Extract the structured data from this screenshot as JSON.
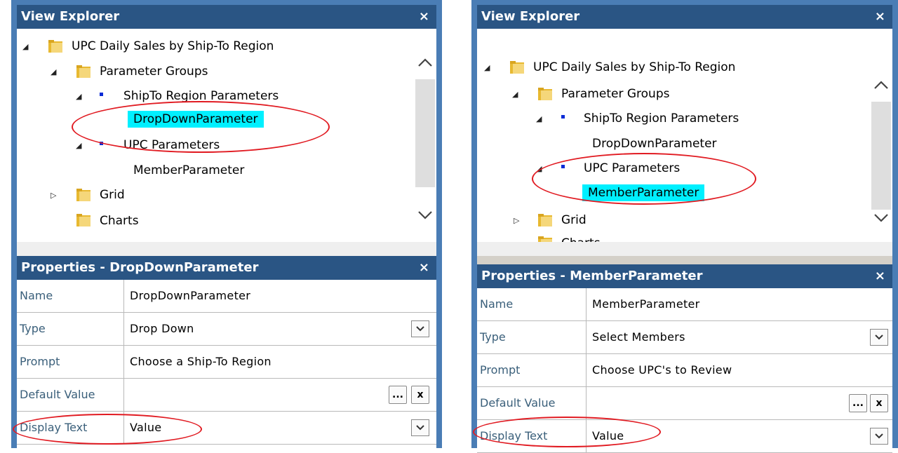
{
  "left": {
    "explorer_title": "View Explorer",
    "tree": {
      "root": "UPC Daily Sales by Ship-To Region",
      "param_groups": "Parameter Groups",
      "group1": "ShipTo Region Parameters",
      "group1_child": "DropDownParameter",
      "group2": "UPC Parameters",
      "group2_child": "MemberParameter",
      "grid": "Grid",
      "charts": "Charts"
    },
    "props_title": "Properties - DropDownParameter",
    "props": [
      {
        "key": "Name",
        "value": "DropDownParameter"
      },
      {
        "key": "Type",
        "value": "Drop Down"
      },
      {
        "key": "Prompt",
        "value": "Choose a Ship-To Region"
      },
      {
        "key": "Default Value",
        "value": ""
      },
      {
        "key": "Display Text",
        "value": "Value"
      }
    ]
  },
  "right": {
    "explorer_title": "View Explorer",
    "tree": {
      "root": "UPC Daily Sales by Ship-To Region",
      "param_groups": "Parameter Groups",
      "group1": "ShipTo Region Parameters",
      "group1_child": "DropDownParameter",
      "group2": "UPC Parameters",
      "group2_child": "MemberParameter",
      "grid": "Grid",
      "charts": "Charts"
    },
    "props_title": "Properties - MemberParameter",
    "props": [
      {
        "key": "Name",
        "value": "MemberParameter"
      },
      {
        "key": "Type",
        "value": "Select Members"
      },
      {
        "key": "Prompt",
        "value": "Choose UPC's to Review"
      },
      {
        "key": "Default Value",
        "value": ""
      },
      {
        "key": "Display Text",
        "value": "Value"
      }
    ]
  },
  "icons": {
    "close": "×",
    "ellipsis": "...",
    "clear": "x"
  },
  "colors": {
    "header": "#2a5584",
    "highlight": "#00f0ff",
    "annotation": "#e11b22",
    "frame": "#4a7db5"
  }
}
